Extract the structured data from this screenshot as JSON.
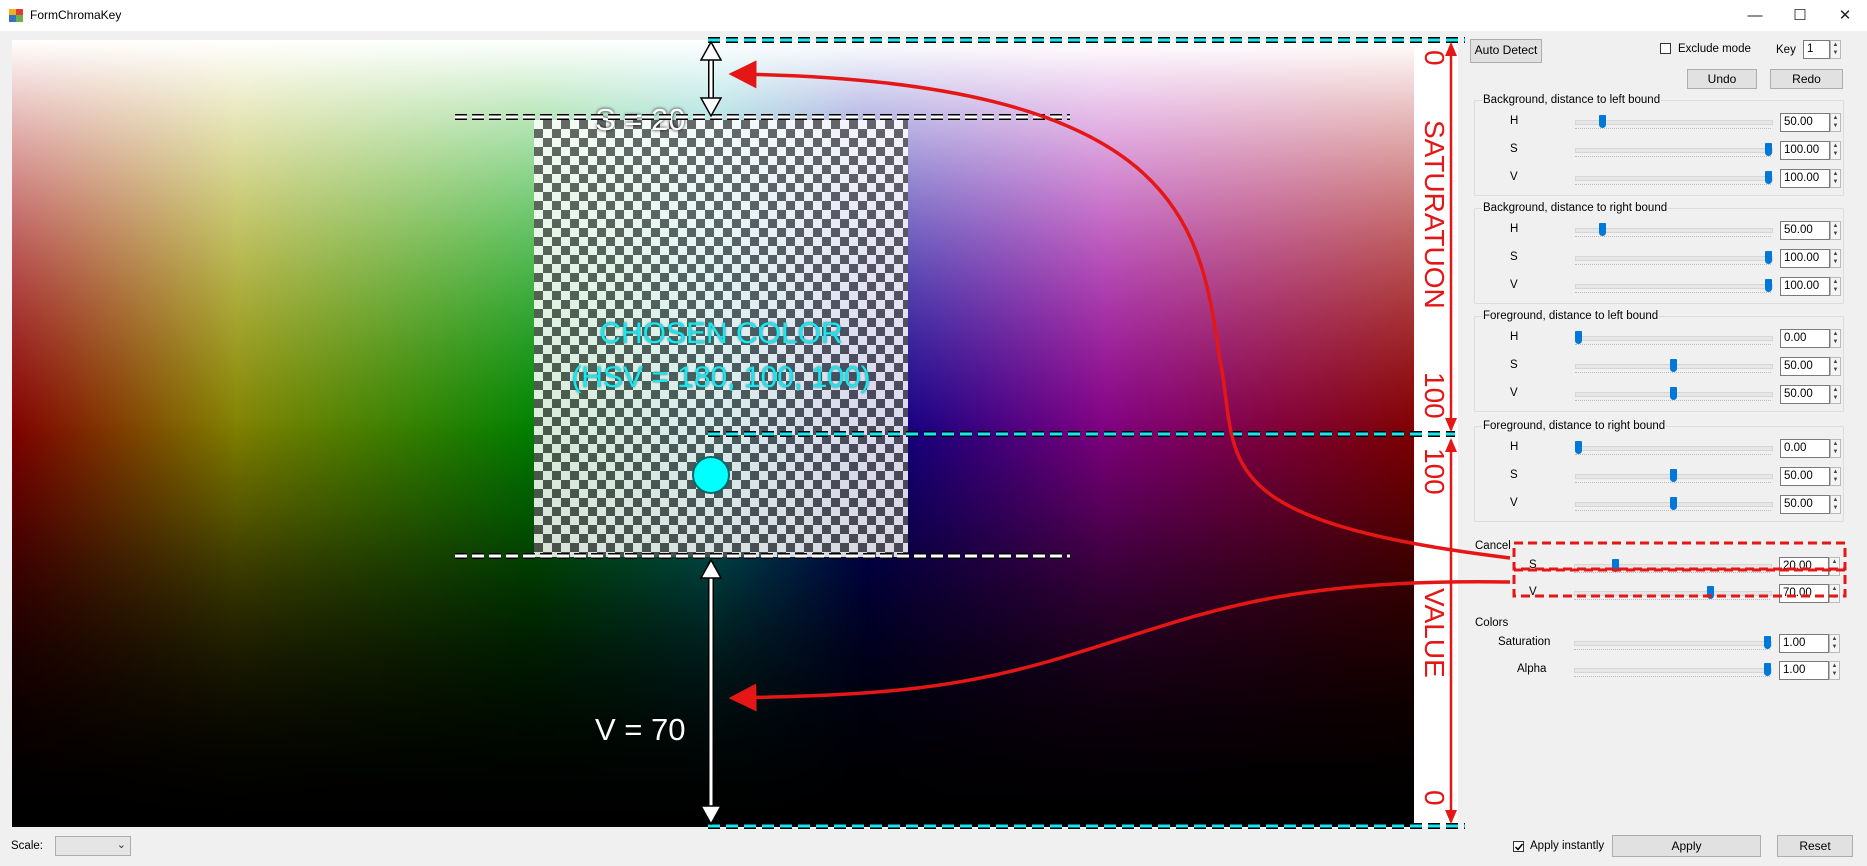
{
  "window": {
    "title": "FormChromaKey",
    "controls": {
      "minimize": "—",
      "maximize": "☐",
      "close": "✕"
    }
  },
  "canvas": {
    "chosen_color_line1": "CHOSEN COLOR",
    "chosen_color_line2": "(HSV = 180, 100, 100)",
    "s_annotation": "S = 20",
    "v_annotation": "V = 70",
    "side_labels": {
      "saturation_top": "0",
      "saturation_word": "SATURATUON",
      "saturation_bottom": "100",
      "value_top": "100",
      "value_word": "VALUE",
      "value_bottom": "0"
    },
    "colors": {
      "annotation_red": "#e51616",
      "guide_cyan": "#19e6ef",
      "chosen_color": "#00ffff"
    }
  },
  "toolbar": {
    "auto_detect": "Auto Detect",
    "exclude_mode": "Exclude mode",
    "exclude_mode_checked": false,
    "key_label": "Key",
    "key_value": "1",
    "undo": "Undo",
    "redo": "Redo"
  },
  "groups": [
    {
      "title": "Background, distance to left bound",
      "rows": [
        {
          "label": "H",
          "value": "50.00",
          "level": 0.125
        },
        {
          "label": "S",
          "value": "100.00",
          "level": 1.0
        },
        {
          "label": "V",
          "value": "100.00",
          "level": 1.0
        }
      ]
    },
    {
      "title": "Background, distance to right bound",
      "rows": [
        {
          "label": "H",
          "value": "50.00",
          "level": 0.125
        },
        {
          "label": "S",
          "value": "100.00",
          "level": 1.0
        },
        {
          "label": "V",
          "value": "100.00",
          "level": 1.0
        }
      ]
    },
    {
      "title": "Foreground, distance to left bound",
      "rows": [
        {
          "label": "H",
          "value": "0.00",
          "level": 0.0
        },
        {
          "label": "S",
          "value": "50.00",
          "level": 0.5
        },
        {
          "label": "V",
          "value": "50.00",
          "level": 0.5
        }
      ]
    },
    {
      "title": "Foreground, distance to right bound",
      "rows": [
        {
          "label": "H",
          "value": "0.00",
          "level": 0.0
        },
        {
          "label": "S",
          "value": "50.00",
          "level": 0.5
        },
        {
          "label": "V",
          "value": "50.00",
          "level": 0.5
        }
      ]
    }
  ],
  "cancel": {
    "title": "Cancel",
    "rows": [
      {
        "label": "S",
        "value": "20.00",
        "level": 0.2
      },
      {
        "label": "V",
        "value": "70.00",
        "level": 0.7
      }
    ]
  },
  "colors_group": {
    "title": "Colors",
    "rows": [
      {
        "label": "Saturation",
        "value": "1.00",
        "level": 1.0
      },
      {
        "label": "Alpha",
        "value": "1.00",
        "level": 1.0
      }
    ]
  },
  "bottom": {
    "scale_label": "Scale:",
    "scale_value": "",
    "apply_instantly": "Apply instantly",
    "apply_instantly_checked": true,
    "apply": "Apply",
    "reset": "Reset"
  }
}
